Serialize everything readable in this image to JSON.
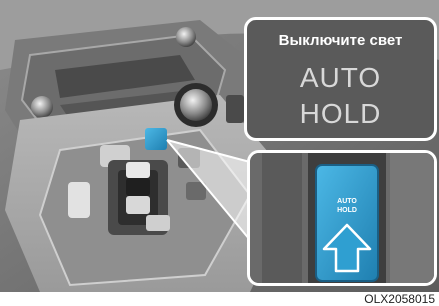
{
  "message": {
    "text": "Выключите свет",
    "display_line_1": "AUTO",
    "display_line_2": "HOLD"
  },
  "button": {
    "label_line_1": "AUTO",
    "label_line_2": "HOLD",
    "color": "#2f9fd1"
  },
  "figure_code": "OLX2058015"
}
